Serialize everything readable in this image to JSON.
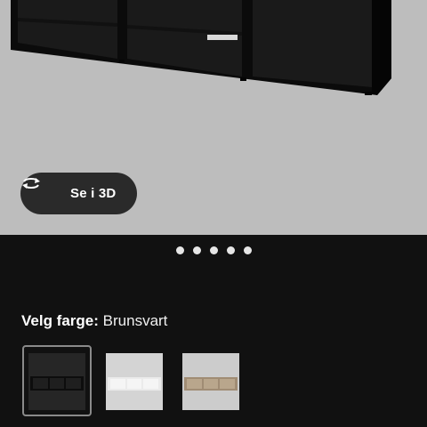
{
  "hero": {
    "view_3d_label": "Se i 3D",
    "view_3d_icon": "rotate-3d-icon",
    "slide_count": 5
  },
  "color_picker": {
    "prompt": "Velg farge:",
    "selected": "Brunsvart",
    "swatches": [
      {
        "name": "black-brown",
        "bg": "#0d0d0d",
        "shelf": "#1c1c1c",
        "selected": true
      },
      {
        "name": "white",
        "bg": "#cfcfcf",
        "shelf": "#e8e8e8",
        "selected": false
      },
      {
        "name": "oak",
        "bg": "#c8c8c8",
        "shelf": "#a89680",
        "selected": false
      }
    ]
  }
}
